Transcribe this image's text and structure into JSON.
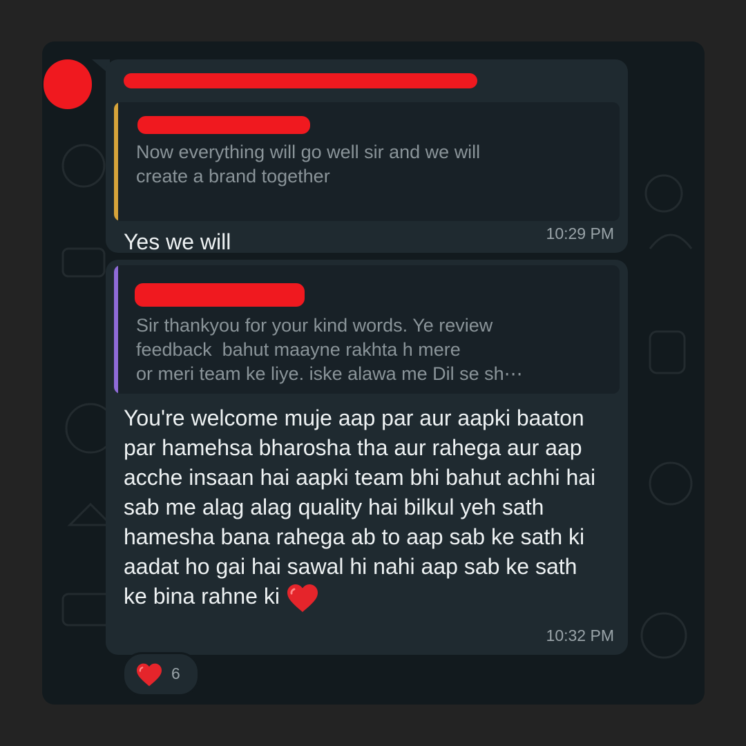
{
  "messages": [
    {
      "quote_text": "Now everything will go well sir and we will\ncreate a brand together",
      "text": "Yes we will",
      "time": "10:29 PM"
    },
    {
      "quote_text": "Sir thankyou for your kind words. Ye review\nfeedback  bahut maayne rakhta h mere\nor meri team ke liye. iske alawa me Dil se sh⋯",
      "text": "You're welcome muje aap par aur aapki baaton par hamehsa bharosha tha aur rahega aur aap acche insaan hai aapki team bhi bahut achhi hai sab me alag alag quality hai  bilkul yeh sath hamesha bana rahega ab to aap sab ke sath ki aadat ho gai hai sawal hi nahi aap sab ke sath ke bina rahne ki",
      "emoji": "heart-icon",
      "time": "10:32 PM"
    }
  ],
  "reaction": {
    "icon": "heart-icon",
    "count": "6"
  },
  "colors": {
    "background": "#121a1e",
    "bubble": "#1f2a30",
    "quote_bar_1": "#d7a43a",
    "quote_bar_2": "#8f6bd8",
    "redaction": "#f0191f"
  }
}
